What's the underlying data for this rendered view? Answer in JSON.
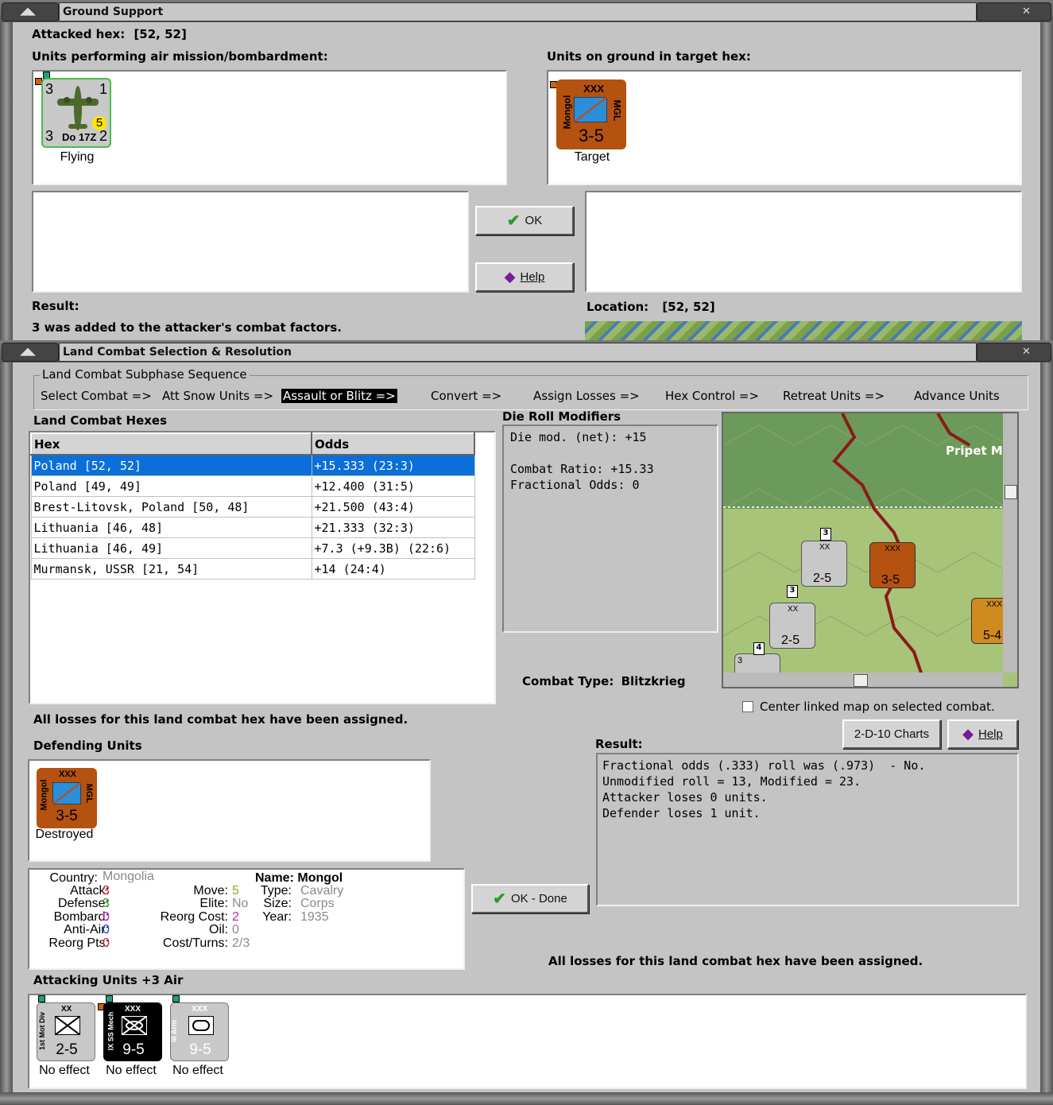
{
  "ground_support": {
    "title": "Ground Support",
    "attacked_hex_label": "Attacked hex:",
    "attacked_hex_value": "[52, 52]",
    "air_units_label": "Units performing air mission/bombardment:",
    "ground_units_label": "Units on ground in target hex:",
    "air_unit": {
      "top_left": "3",
      "top_right": "1",
      "bottom_left": "3",
      "bottom_right": "2",
      "name": "Do 17Z",
      "range": "5",
      "status": "Flying"
    },
    "ground_unit": {
      "size": "XXX",
      "name": "Mongol",
      "nation": "MGL",
      "strength": "3-5",
      "status": "Target"
    },
    "ok_label": "OK",
    "help_label": "Help",
    "result_label": "Result:",
    "result_text": "3 was added to the attacker's combat factors.",
    "location_label": "Location:",
    "location_value": "[52, 52]"
  },
  "land_combat": {
    "title": "Land Combat Selection & Resolution",
    "sequence_title": "Land Combat Subphase Sequence",
    "phases": [
      "Select Combat =>",
      "Att Snow Units =>",
      "Assault or Blitz =>",
      "Convert =>",
      "Assign Losses =>",
      "Hex Control =>",
      "Retreat Units =>",
      "Advance Units"
    ],
    "active_phase_index": 2,
    "hexes_label": "Land Combat Hexes",
    "table_headers": [
      "Hex",
      "Odds"
    ],
    "table_rows": [
      [
        "Poland [52, 52]",
        "+15.333 (23:3)"
      ],
      [
        "Poland [49, 49]",
        "+12.400 (31:5)"
      ],
      [
        "Brest-Litovsk, Poland [50, 48]",
        "+21.500 (43:4)"
      ],
      [
        "Lithuania [46, 48]",
        "+21.333 (32:3)"
      ],
      [
        "Lithuania [46, 49]",
        "+7.3 (+9.3B) (22:6)"
      ],
      [
        "Murmansk, USSR [21, 54]",
        "+14 (24:4)"
      ]
    ],
    "die_roll_label": "Die Roll Modifiers",
    "die_roll_lines": [
      "Die mod. (net): +15",
      "",
      "Combat Ratio: +15.33",
      "Fractional Odds: 0"
    ],
    "combat_type_label": "Combat Type:",
    "combat_type_value": "Blitzkrieg",
    "center_map_label": "Center linked map on selected combat.",
    "losses_assigned_msg": "All losses for this land combat hex have been assigned.",
    "defending_label": "Defending Units",
    "defender": {
      "size": "XXX",
      "name": "Mongol",
      "nation": "MGL",
      "strength": "3-5",
      "status": "Destroyed"
    },
    "charts_label": "2-D-10 Charts",
    "help_label": "Help",
    "result_label": "Result:",
    "result_lines": [
      "Fractional odds (.333) roll was (.973)  - No.",
      "Unmodified roll = 13, Modified = 23.",
      "Attacker loses 0 units.",
      "Defender loses 1 unit."
    ],
    "ok_done_label": "OK - Done",
    "bottom_msg": "All losses for this land combat hex have been assigned.",
    "unit_info": {
      "country_k": "Country:",
      "country_v": "Mongolia",
      "attack_k": "Attack:",
      "attack_v": "3",
      "defense_k": "Defense:",
      "defense_v": "3",
      "bombard_k": "Bombard:",
      "bombard_v": "0",
      "antiair_k": "Anti-Air:",
      "antiair_v": "0",
      "reorgpts_k": "Reorg Pts:",
      "reorgpts_v": "0",
      "move_k": "Move:",
      "move_v": "5",
      "elite_k": "Elite:",
      "elite_v": "No",
      "reorgcost_k": "Reorg Cost:",
      "reorgcost_v": "2",
      "oil_k": "Oil:",
      "oil_v": "0",
      "cost_k": "Cost/Turns:",
      "cost_v": "2/3",
      "name_k": "Name:",
      "name_v": "Mongol",
      "type_k": "Type:",
      "type_v": "Cavalry",
      "size_k": "Size:",
      "size_v": "Corps",
      "year_k": "Year:",
      "year_v": "1935"
    },
    "attacking_label": "Attacking Units +3 Air",
    "attackers": [
      {
        "size": "XX",
        "name": "1st Mot Div",
        "strength": "2-5",
        "status": "No effect"
      },
      {
        "size": "XXX",
        "name": "IX SS Mech",
        "strength": "9-5",
        "status": "No effect"
      },
      {
        "size": "XXX",
        "name": "III Arm",
        "strength": "9-5",
        "status": "No effect"
      }
    ],
    "map": {
      "region_label": "Pripet M",
      "units": [
        {
          "size": "XX",
          "strength": "2-5",
          "stack": "3"
        },
        {
          "size": "XXX",
          "strength": "3-5",
          "stack": ""
        },
        {
          "size": "XX",
          "strength": "2-5",
          "stack": "3"
        },
        {
          "size": "XXX",
          "strength": "5-4",
          "stack": ""
        },
        {
          "size": "",
          "strength": "3",
          "stack": "4"
        }
      ]
    }
  },
  "colors": {
    "selection": "#0a6fd8",
    "soviet_counter": "#b5520f",
    "german_counter": "#c8c8c8",
    "ss_counter": "#000000",
    "map_border": "#8b1a1a"
  }
}
